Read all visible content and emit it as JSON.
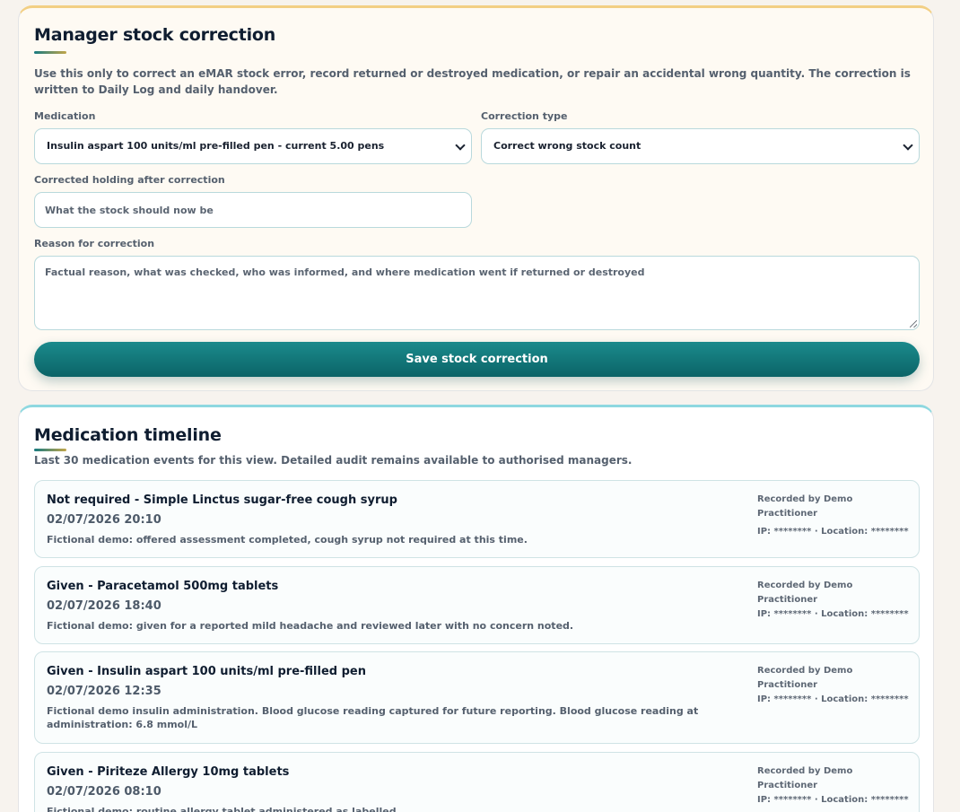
{
  "correction": {
    "title": "Manager stock correction",
    "intro": "Use this only to correct an eMAR stock error, record returned or destroyed medication, or repair an accidental wrong quantity. The correction is written to Daily Log and daily handover.",
    "medication_label": "Medication",
    "medication_value": "Insulin aspart 100 units/ml pre-filled pen - current 5.00 pens",
    "correction_type_label": "Correction type",
    "correction_type_value": "Correct wrong stock count",
    "holding_label": "Corrected holding after correction",
    "holding_placeholder": "What the stock should now be",
    "reason_label": "Reason for correction",
    "reason_placeholder": "Factual reason, what was checked, who was informed, and where medication went if returned or destroyed",
    "save_label": "Save stock correction"
  },
  "timeline": {
    "title": "Medication timeline",
    "subtitle": "Last 30 medication events for this view. Detailed audit remains available to authorised managers.",
    "events": [
      {
        "title": "Not required - Simple Linctus sugar-free cough syrup",
        "datetime": "02/07/2026 20:10",
        "note": "Fictional demo: offered assessment completed, cough syrup not required at this time.",
        "recorded_by": "Recorded by Demo Practitioner",
        "ip_location": "IP: ******** · Location: ********"
      },
      {
        "title": "Given - Paracetamol 500mg tablets",
        "datetime": "02/07/2026 18:40",
        "note": "Fictional demo: given for a reported mild headache and reviewed later with no concern noted.",
        "recorded_by": "Recorded by Demo Practitioner",
        "ip_location": "IP: ******** · Location: ********"
      },
      {
        "title": "Given - Insulin aspart 100 units/ml pre-filled pen",
        "datetime": "02/07/2026 12:35",
        "note": "Fictional demo insulin administration. Blood glucose reading captured for future reporting. Blood glucose reading at administration: 6.8 mmol/L",
        "recorded_by": "Recorded by Demo Practitioner",
        "ip_location": "IP: ******** · Location: ********"
      },
      {
        "title": "Given - Piriteze Allergy 10mg tablets",
        "datetime": "02/07/2026 08:10",
        "note": "Fictional demo: routine allergy tablet administered as labelled.",
        "recorded_by": "Recorded by Demo Practitioner",
        "ip_location": "IP: ******** · Location: ********"
      }
    ]
  },
  "colors": {
    "accent": "#0b6467",
    "correction_border": "#f2cf84",
    "timeline_border": "#8ed8e0"
  }
}
